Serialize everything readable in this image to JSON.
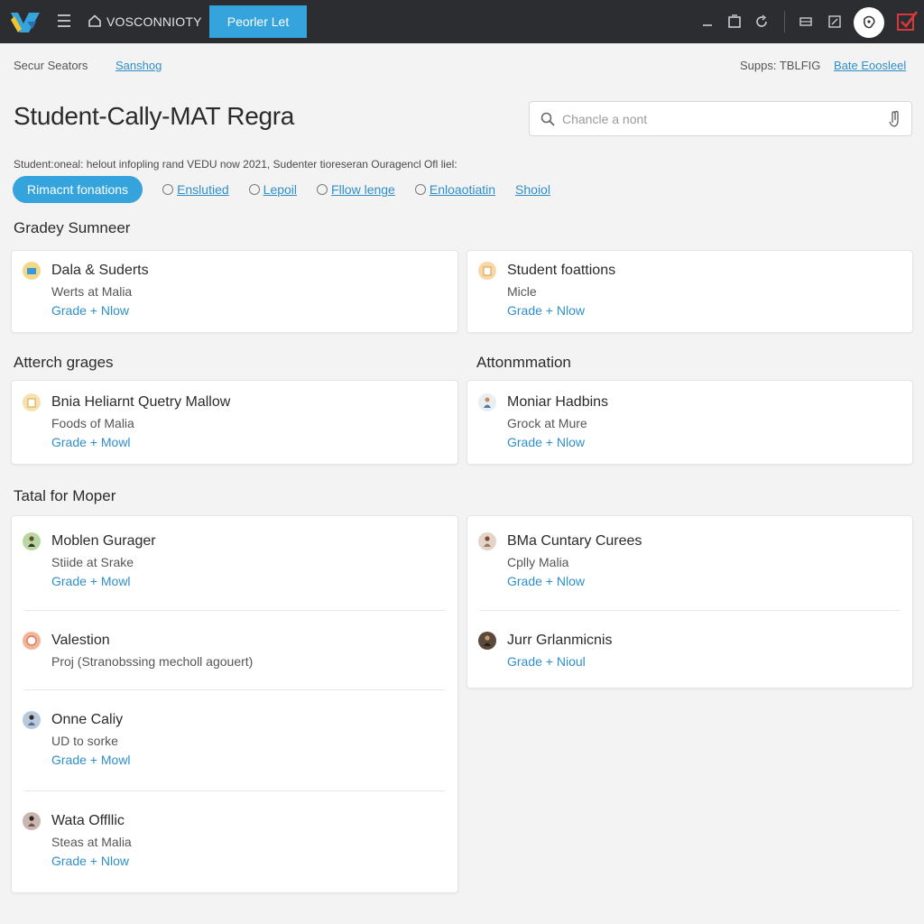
{
  "topbar": {
    "app_name": "VOSCONNIOTY",
    "primary_button": "Peorler Let",
    "colors": {
      "bar": "#2c2d31",
      "accent": "#35a3dc",
      "alert": "#d8383b"
    },
    "icons": [
      "logo-icon",
      "menu-icon",
      "home-icon",
      "minimize-icon",
      "window-icon",
      "refresh-icon",
      "grid-icon",
      "edit-icon",
      "profile-icon",
      "checkbox-icon"
    ]
  },
  "subheader": {
    "crumb": "Secur Seators",
    "crumb_link": "Sanshog",
    "status": "Supps: TBLFIG",
    "status_link": "Bate Eoosleel"
  },
  "page": {
    "title": "Student-Cally-MAT Regra",
    "description": "Student:oneal: helout infopling rand VEDU now 2021, Sudenter tioreseran Ouragencl Ofl liel:"
  },
  "search": {
    "placeholder": "Chancle a nont"
  },
  "filters": {
    "active": "Rimacnt fonations",
    "options": [
      "Enslutied",
      "Lepoil",
      "Fllow lenge",
      "Enloaotiatin"
    ],
    "extra": "Shoiol"
  },
  "sections": {
    "s1": "Gradey Sumneer",
    "s2a": "Atterch grages",
    "s2b": "Attonmmation",
    "s3": "Tatal for Moper"
  },
  "cards": {
    "c1": {
      "title": "Dala & Suderts",
      "sub": "Werts at Malia",
      "link": "Grade  +  Nlow"
    },
    "c2": {
      "title": "Student foattions",
      "sub": "Micle",
      "link": "Grade  +  Nlow"
    },
    "c3": {
      "title": "Bnia Heliarnt Quetry Mallow",
      "sub": "Foods of Malia",
      "link": "Grade  +  Mowl"
    },
    "c4": {
      "title": "Moniar Hadbins",
      "sub": "Grock at Mure",
      "link": "Grade  +  Nlow"
    },
    "left_list": [
      {
        "title": "Moblen Gurager",
        "sub": "Stiide at Srake",
        "link": "Grade  +  Mowl"
      },
      {
        "title": "Valestion",
        "sub": "Proj (Stranobssing mecholl agouert)"
      },
      {
        "title": "Onne Caliy",
        "sub": "UD to sorke",
        "link": "Grade  +  Mowl"
      },
      {
        "title": "Wata Offllic",
        "sub": "Steas at Malia",
        "link": "Grade  +  Nlow"
      }
    ],
    "right_list": [
      {
        "title": "BMa Cuntary Curees",
        "sub": "Cplly Malia",
        "link": "Grade  +  Nlow"
      },
      {
        "title": "Jurr Grlanmicnis",
        "link": "Grade  +  Nioul"
      }
    ]
  }
}
